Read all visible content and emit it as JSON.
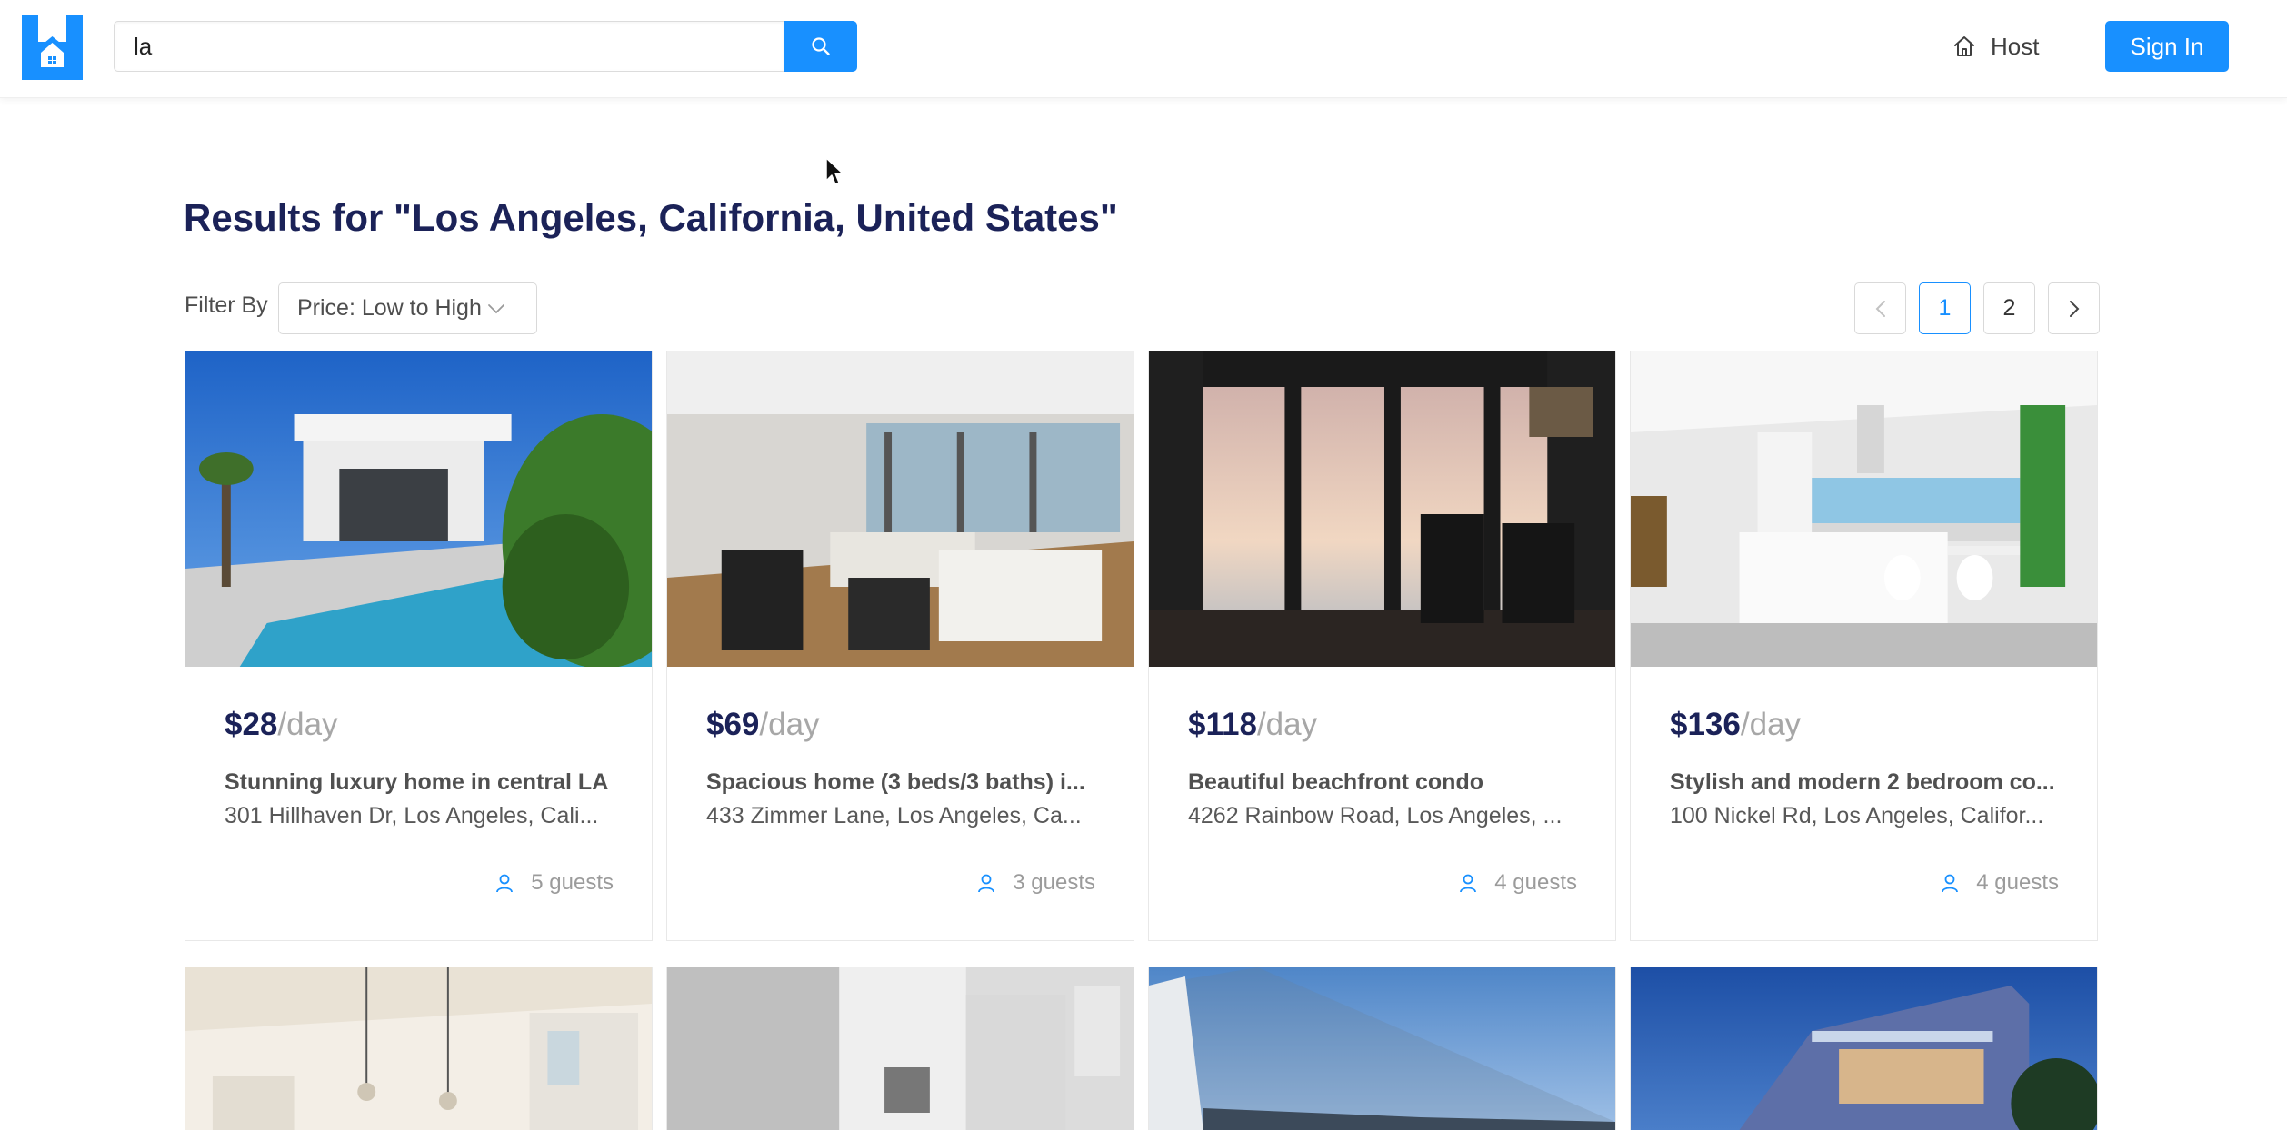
{
  "header": {
    "logo_name": "house-logo",
    "search": {
      "value": "la",
      "placeholder": ""
    },
    "host_label": "Host",
    "signin_label": "Sign In"
  },
  "results": {
    "title": "Results for \"Los Angeles, California, United States\"",
    "filter_label": "Filter By",
    "filter_value": "Price: Low to High"
  },
  "pagination": {
    "pages": [
      "1",
      "2"
    ],
    "current": "1"
  },
  "listings": [
    {
      "price": "$28",
      "per": "/day",
      "title": "Stunning luxury home in central LA",
      "address": "301 Hillhaven Dr, Los Angeles, Cali...",
      "guests": "5 guests"
    },
    {
      "price": "$69",
      "per": "/day",
      "title": "Spacious home (3 beds/3 baths) i...",
      "address": "433 Zimmer Lane, Los Angeles, Ca...",
      "guests": "3 guests"
    },
    {
      "price": "$118",
      "per": "/day",
      "title": "Beautiful beachfront condo",
      "address": "4262 Rainbow Road, Los Angeles, ...",
      "guests": "4 guests"
    },
    {
      "price": "$136",
      "per": "/day",
      "title": "Stylish and modern 2 bedroom co...",
      "address": "100 Nickel Rd, Los Angeles, Califor...",
      "guests": "4 guests"
    }
  ],
  "colors": {
    "accent": "#1890ff",
    "title": "#1b2258"
  }
}
